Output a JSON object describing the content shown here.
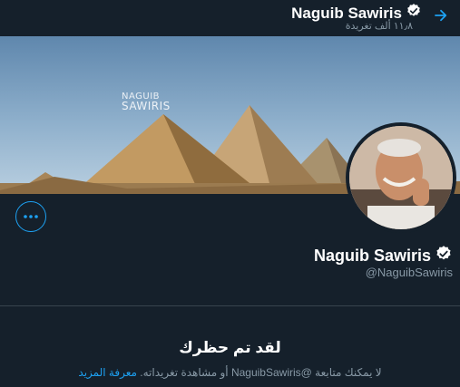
{
  "header": {
    "name": "Naguib Sawiris",
    "tweet_count": "١١٫٨ ألف تغريدة"
  },
  "banner": {
    "logo_line1": "NAGUIB",
    "logo_line2": "SAWIRIS"
  },
  "profile": {
    "name": "Naguib Sawiris",
    "handle": "@NaguibSawiris"
  },
  "blocked": {
    "title": "لقد تم حظرك",
    "message": "لا يمكنك متابعة @NaguibSawiris أو مشاهدة تغريداته.",
    "learn_more": "معرفة المزيد"
  },
  "colors": {
    "background": "#15202b",
    "accent": "#1da1f2",
    "secondary_text": "#8899a6",
    "divider": "#38444d"
  },
  "icons": {
    "back": "arrow-right-icon",
    "verified": "verified-badge-icon",
    "more": "more-options-icon"
  }
}
